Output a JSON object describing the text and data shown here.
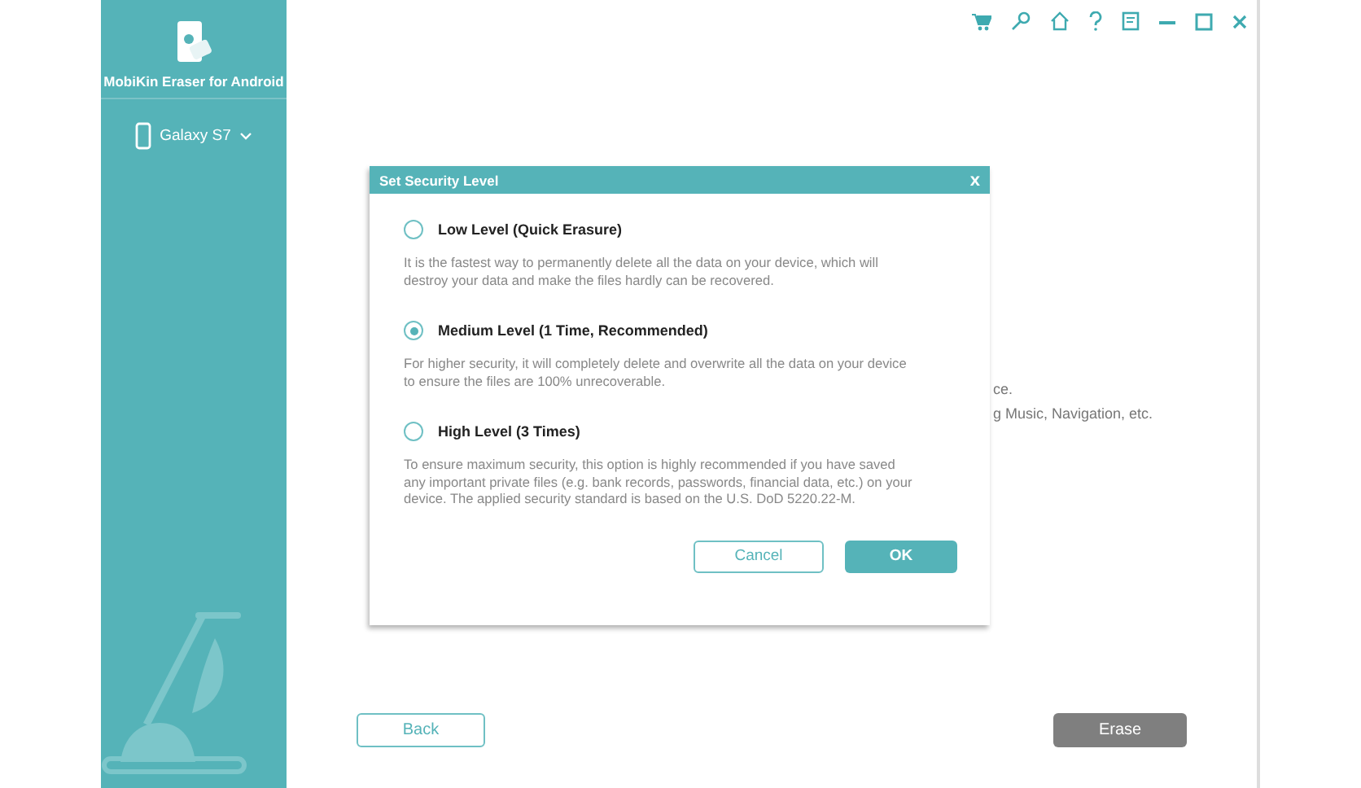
{
  "app": {
    "title": "MobiKin Eraser for Android"
  },
  "device": {
    "name": "Galaxy S7"
  },
  "background_text": [
    "ce.",
    "g Music, Navigation, etc."
  ],
  "dialog": {
    "title": "Set Security Level",
    "close": "x",
    "options": [
      {
        "label": "Low Level (Quick Erasure)",
        "selected": false,
        "description": "It is the fastest way to permanently delete all the data on your device, which will destroy your data and make the files hardly can be recovered."
      },
      {
        "label": "Medium Level (1 Time, Recommended)",
        "selected": true,
        "description": "For higher security, it will completely delete and overwrite all the data on your device to ensure the files are 100% unrecoverable."
      },
      {
        "label": "High Level (3 Times)",
        "selected": false,
        "description": "To ensure maximum security, this option is highly recommended if you have saved any important private files (e.g. bank records, passwords, financial data, etc.) on your device. The applied security standard is based on the U.S. DoD 5220.22-M."
      }
    ],
    "buttons": [
      "Cancel",
      "OK"
    ]
  },
  "footer": {
    "back": "Back",
    "erase": "Erase"
  }
}
